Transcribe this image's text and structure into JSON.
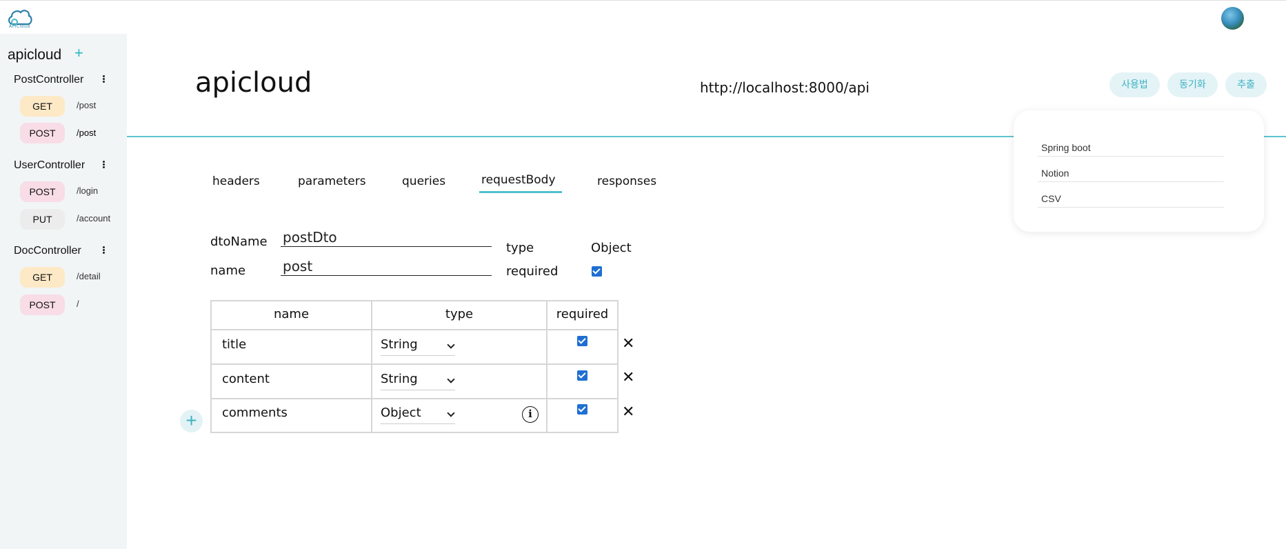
{
  "app": {
    "logo_text": "APICloud"
  },
  "sidebar": {
    "project_title": "apicloud",
    "add_icon": "plus-icon",
    "controllers": [
      {
        "name": "PostController",
        "endpoints": [
          {
            "method": "GET",
            "path": "/post"
          },
          {
            "method": "POST",
            "path": "/post"
          }
        ]
      },
      {
        "name": "UserController",
        "endpoints": [
          {
            "method": "POST",
            "path": "/login"
          },
          {
            "method": "PUT",
            "path": "/account"
          }
        ]
      },
      {
        "name": "DocController",
        "endpoints": [
          {
            "method": "GET",
            "path": "/detail"
          },
          {
            "method": "POST",
            "path": "/"
          }
        ]
      }
    ]
  },
  "header": {
    "title": "apicloud",
    "base_url": "http://localhost:8000/api",
    "buttons": {
      "usage": "사용법",
      "sync": "동기화",
      "export": "추출"
    }
  },
  "export_menu": {
    "items": [
      "Spring boot",
      "Notion",
      "CSV"
    ]
  },
  "tabs": {
    "items": [
      "headers",
      "parameters",
      "queries",
      "requestBody",
      "responses"
    ],
    "active": "requestBody"
  },
  "dto_form": {
    "dto_name_label": "dtoName",
    "dto_name_value": "postDto",
    "name_label": "name",
    "name_value": "post",
    "type_label": "type",
    "type_value": "Object",
    "required_label": "required",
    "required_checked": true
  },
  "fields_table": {
    "headers": {
      "name": "name",
      "type": "type",
      "required": "required"
    },
    "rows": [
      {
        "name": "title",
        "type": "String",
        "required": true
      },
      {
        "name": "content",
        "type": "String",
        "required": true
      },
      {
        "name": "comments",
        "type": "Object",
        "required": true
      }
    ],
    "delete_symbol": "✕",
    "info_symbol": "i",
    "add_symbol": "+"
  },
  "colors": {
    "accent": "#4fc0cc",
    "get_badge": "#fde9c6",
    "post_badge": "#f8dce6",
    "put_badge": "#ececec",
    "sidebar_bg": "#f1f5f6",
    "checkbox": "#1f6fd1"
  }
}
